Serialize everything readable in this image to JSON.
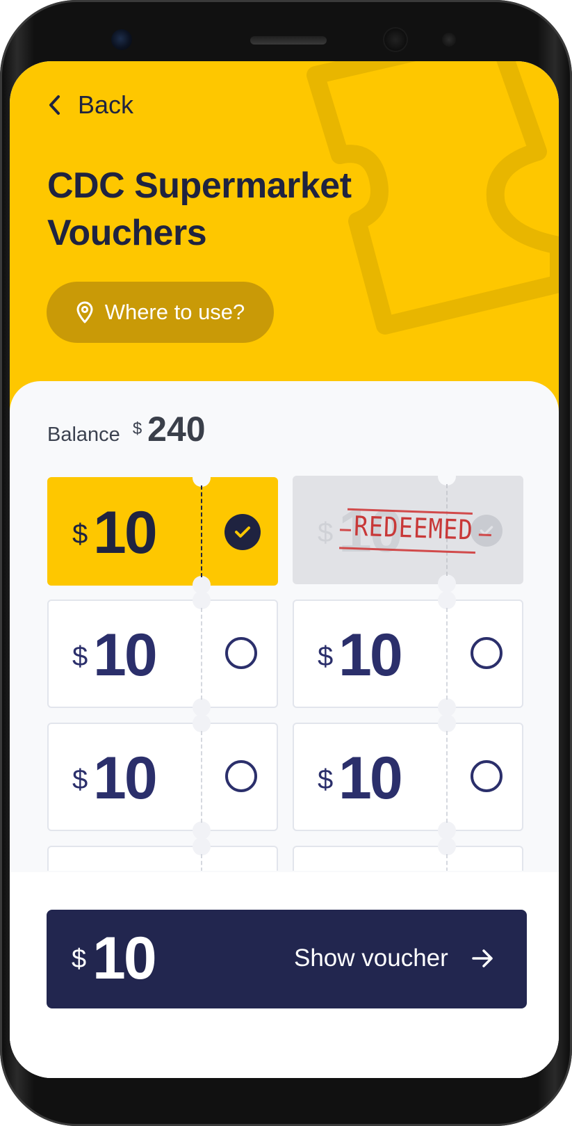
{
  "header": {
    "back_label": "Back",
    "title": "CDC Supermarket Vouchers",
    "where_label": "Where to use?"
  },
  "balance": {
    "label": "Balance",
    "currency": "$",
    "amount": "240"
  },
  "vouchers": [
    {
      "currency": "$",
      "amount": "10",
      "state": "selected"
    },
    {
      "currency": "$",
      "amount": "10",
      "state": "redeemed",
      "stamp": "REDEEMED"
    },
    {
      "currency": "$",
      "amount": "10",
      "state": "unselected"
    },
    {
      "currency": "$",
      "amount": "10",
      "state": "unselected"
    },
    {
      "currency": "$",
      "amount": "10",
      "state": "unselected"
    },
    {
      "currency": "$",
      "amount": "10",
      "state": "unselected"
    }
  ],
  "footer": {
    "currency": "$",
    "amount": "10",
    "show_label": "Show voucher"
  },
  "colors": {
    "accent": "#fec700",
    "navy": "#22264f",
    "text": "#1f2340",
    "stamp": "#c83838"
  }
}
